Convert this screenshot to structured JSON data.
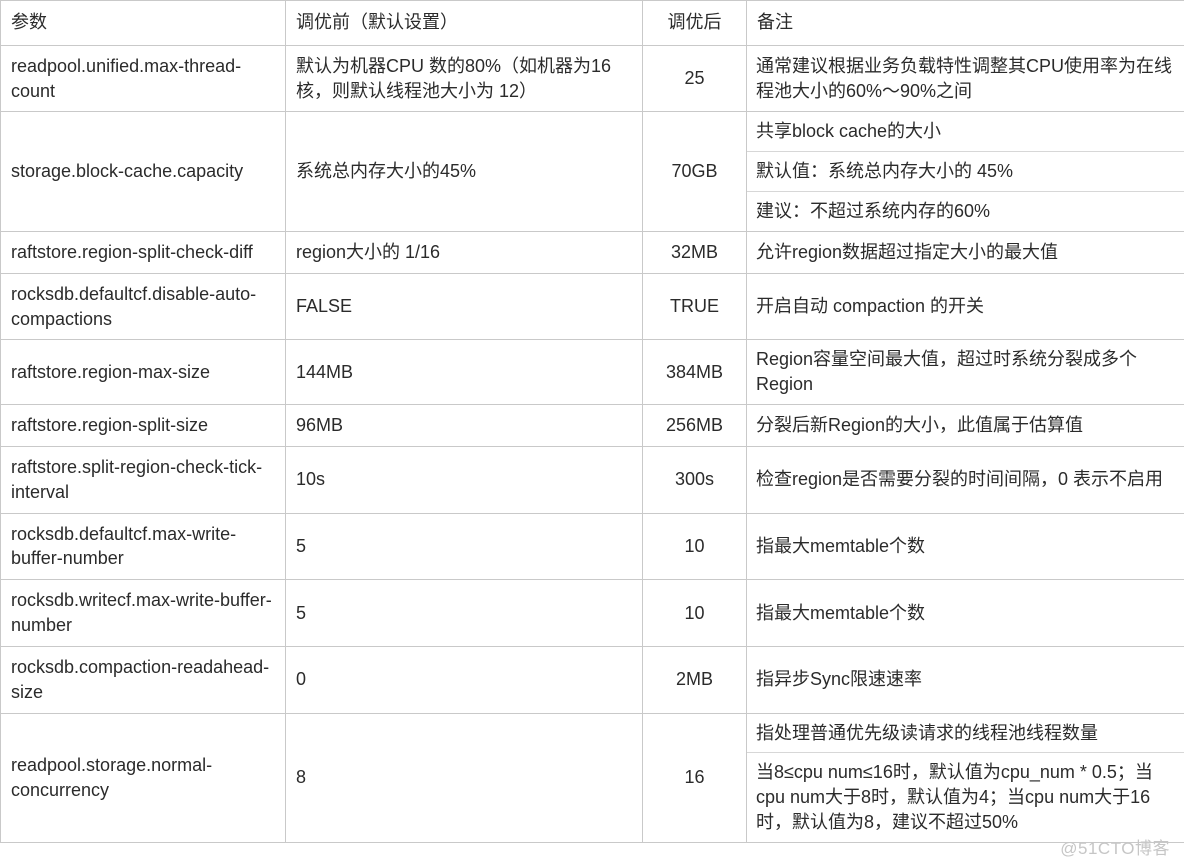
{
  "table": {
    "columns": [
      {
        "key": "param",
        "label": "参数"
      },
      {
        "key": "before",
        "label": "调优前（默认设置）"
      },
      {
        "key": "after",
        "label": "调优后"
      },
      {
        "key": "note",
        "label": "备注"
      }
    ],
    "rows": [
      {
        "param": "readpool.unified.max-thread-count",
        "before": "默认为机器CPU 数的80%（如机器为16核，则默认线程池大小为 12）",
        "after": "25",
        "note_lines": [
          "通常建议根据业务负载特性调整其CPU使用率为在线程池大小的60%～90%之间"
        ]
      },
      {
        "param": "storage.block-cache.capacity",
        "before": "系统总内存大小的45%",
        "after": "70GB",
        "note_lines": [
          "共享block cache的大小",
          "默认值：系统总内存大小的 45%",
          "建议：不超过系统内存的60%"
        ]
      },
      {
        "param": "raftstore.region-split-check-diff",
        "before": "region大小的 1/16",
        "after": "32MB",
        "note_lines": [
          "允许region数据超过指定大小的最大值"
        ]
      },
      {
        "param": "rocksdb.defaultcf.disable-auto-compactions",
        "before": "FALSE",
        "after": "TRUE",
        "note_lines": [
          "开启自动 compaction 的开关"
        ]
      },
      {
        "param": "raftstore.region-max-size",
        "before": "144MB",
        "after": "384MB",
        "note_lines": [
          "Region容量空间最大值，超过时系统分裂成多个Region"
        ]
      },
      {
        "param": "raftstore.region-split-size",
        "before": "96MB",
        "after": "256MB",
        "note_lines": [
          "分裂后新Region的大小，此值属于估算值"
        ]
      },
      {
        "param": "raftstore.split-region-check-tick-interval",
        "before": "10s",
        "after": "300s",
        "note_lines": [
          "检查region是否需要分裂的时间间隔，0 表示不启用"
        ]
      },
      {
        "param": "rocksdb.defaultcf.max-write-buffer-number",
        "before": "5",
        "after": "10",
        "note_lines": [
          "指最大memtable个数"
        ]
      },
      {
        "param": "rocksdb.writecf.max-write-buffer-number",
        "before": "5",
        "after": "10",
        "note_lines": [
          "指最大memtable个数"
        ]
      },
      {
        "param": "rocksdb.compaction-readahead-size",
        "before": "0",
        "after": "2MB",
        "note_lines": [
          "指异步Sync限速速率"
        ]
      },
      {
        "param": "readpool.storage.normal-concurrency",
        "before": "8",
        "after": "16",
        "note_lines": [
          "指处理普通优先级读请求的线程池线程数量",
          "当8≤cpu num≤16时，默认值为cpu_num * 0.5；当cpu num大于8时，默认值为4；当cpu num大于16时，默认值为8，建议不超过50%"
        ]
      }
    ]
  },
  "watermark": {
    "text": "@51CTO博客"
  },
  "colors": {
    "border": "#c9c9c9",
    "inner_border": "#d7d7d7",
    "text": "#2b2b2b",
    "header_text": "#000000",
    "watermark": "#c6c6c6",
    "background": "#ffffff"
  }
}
